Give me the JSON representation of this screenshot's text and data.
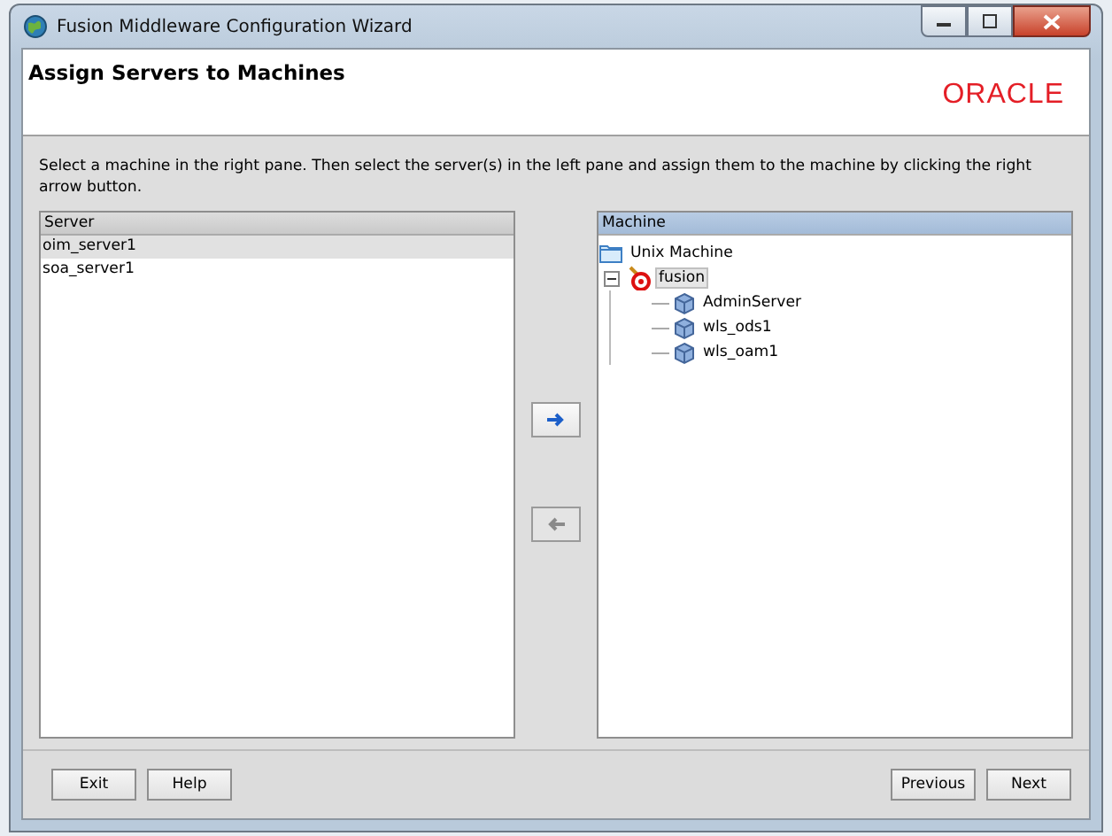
{
  "window": {
    "title": "Fusion Middleware Configuration Wizard"
  },
  "header": {
    "title": "Assign Servers to Machines",
    "logo": "ORACLE"
  },
  "instructions": "Select a machine in the right pane. Then select the server(s) in the left pane and assign them to the machine by clicking the right arrow button.",
  "server_list": {
    "heading": "Server",
    "items": [
      {
        "label": "oim_server1",
        "selected": true
      },
      {
        "label": "soa_server1",
        "selected": false
      }
    ]
  },
  "move_buttons": [
    {
      "kind": "right",
      "disabled": false
    },
    {
      "kind": "left",
      "disabled": true
    }
  ],
  "machine_tree": {
    "heading": "Machine",
    "items": [
      {
        "label": "Unix Machine",
        "kind": "folder",
        "selected": false
      },
      {
        "label": "fusion",
        "kind": "machine",
        "selected": true,
        "expanded": true,
        "children": [
          {
            "label": "AdminServer",
            "kind": "server",
            "selected": false
          },
          {
            "label": "wls_ods1",
            "kind": "server",
            "selected": false
          },
          {
            "label": "wls_oam1",
            "kind": "server",
            "selected": false
          }
        ]
      }
    ]
  },
  "footer": {
    "left_buttons": [
      "Exit",
      "Help"
    ],
    "right_buttons": [
      "Previous",
      "Next"
    ]
  }
}
